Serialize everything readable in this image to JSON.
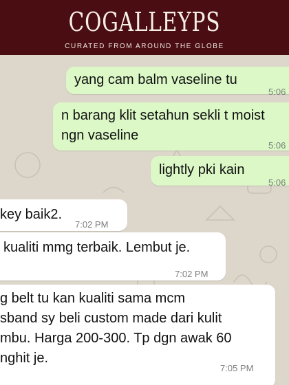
{
  "header": {
    "brand": "COGALLEYPS",
    "tagline": "CURATED FROM AROUND THE GLOBE"
  },
  "messages": [
    {
      "direction": "outgoing",
      "lines": [
        "yang cam balm vaseline tu"
      ],
      "time": "5:06"
    },
    {
      "direction": "outgoing",
      "lines": [
        "n barang klit setahun sekli t moist",
        "ngn vaseline"
      ],
      "time": "5:06"
    },
    {
      "direction": "outgoing",
      "lines": [
        "lightly pki kain"
      ],
      "time": "5:06"
    },
    {
      "direction": "incoming",
      "lines": [
        "key baik2."
      ],
      "time": "7:02 PM"
    },
    {
      "direction": "incoming",
      "lines": [
        "kualiti mmg terbaik. Lembut je."
      ],
      "time": "7:02 PM"
    },
    {
      "direction": "incoming",
      "lines": [
        "g belt tu kan kualiti sama mcm",
        "sband sy beli custom made dari kulit",
        "mbu. Harga 200-300. Tp dgn awak 60",
        "nghit je."
      ],
      "time": "7:05 PM"
    }
  ],
  "colors": {
    "header_bg": "#4a0d12",
    "outgoing_bubble": "#dbf8c6",
    "incoming_bubble": "#ffffff",
    "chat_bg": "#ddd6cb"
  }
}
